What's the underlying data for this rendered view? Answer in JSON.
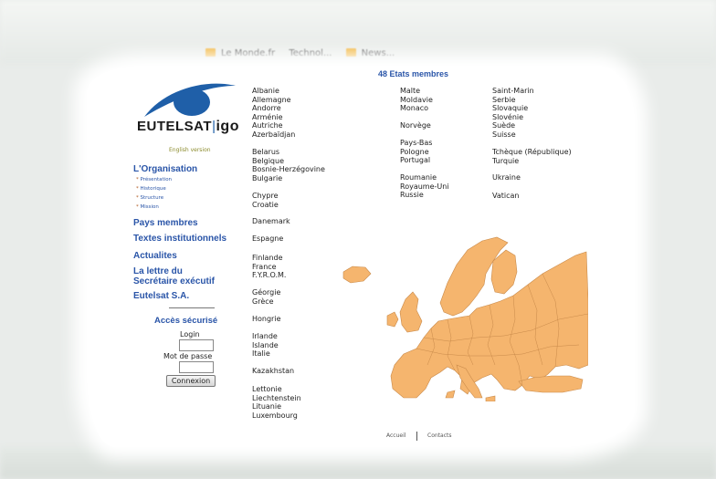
{
  "browser": {
    "bookmarks": [
      "Le Monde.fr",
      "Technol...",
      "News..."
    ]
  },
  "logo": {
    "main": "EUTELSAT",
    "suffix": "igo"
  },
  "english_version": "English version",
  "nav": {
    "organisation": "L'Organisation",
    "sub_items": [
      "Présentation",
      "Historique",
      "Structure",
      "Mission"
    ],
    "pays": "Pays membres",
    "textes": "Textes institutionnels",
    "actualites": "Actualites",
    "lettre_l1": "La lettre du",
    "lettre_l2": "Secrétaire exécutif",
    "eutelsat_sa": "Eutelsat S.A."
  },
  "login": {
    "title": "Accès sécurisé",
    "login_label": "Login",
    "password_label": "Mot de passe",
    "button": "Connexion"
  },
  "members_title": "48 Etats membres",
  "countries": {
    "col1": [
      [
        "Albanie",
        "Allemagne",
        "Andorre",
        "Arménie",
        "Autriche",
        "Azerbaïdjan"
      ],
      [
        "Belarus",
        "Belgique",
        "Bosnie-Herzégovine",
        "Bulgarie"
      ],
      [
        "Chypre",
        "Croatie"
      ],
      [
        "Danemark"
      ],
      [
        "Espagne"
      ],
      [
        "Finlande",
        "France",
        "F.Y.R.O.M."
      ],
      [
        "Géorgie",
        "Grèce"
      ],
      [
        "Hongrie"
      ],
      [
        "Irlande",
        "Islande",
        "Italie"
      ],
      [
        "Kazakhstan"
      ],
      [
        "Lettonie",
        "Liechtenstein",
        "Lituanie",
        "Luxembourg"
      ]
    ],
    "col2": [
      [
        "Malte",
        "Moldavie",
        "Monaco"
      ],
      [
        "Norvège"
      ],
      [
        "Pays-Bas",
        "Pologne",
        "Portugal"
      ],
      [
        "Roumanie",
        "Royaume-Uni",
        "Russie"
      ]
    ],
    "col3": [
      [
        "Saint-Marin",
        "Serbie",
        "Slovaquie",
        "Slovénie",
        "Suède",
        "Suisse"
      ],
      [
        "Tchèque (République)",
        "Turquie"
      ],
      [
        "Ukraine"
      ],
      [
        "Vatican"
      ]
    ]
  },
  "footer": {
    "accueil": "Accueil",
    "contacts": "Contacts"
  },
  "colors": {
    "link": "#2a55a8",
    "map": "#f5b56e",
    "logo_blue": "#1f5fa8"
  }
}
